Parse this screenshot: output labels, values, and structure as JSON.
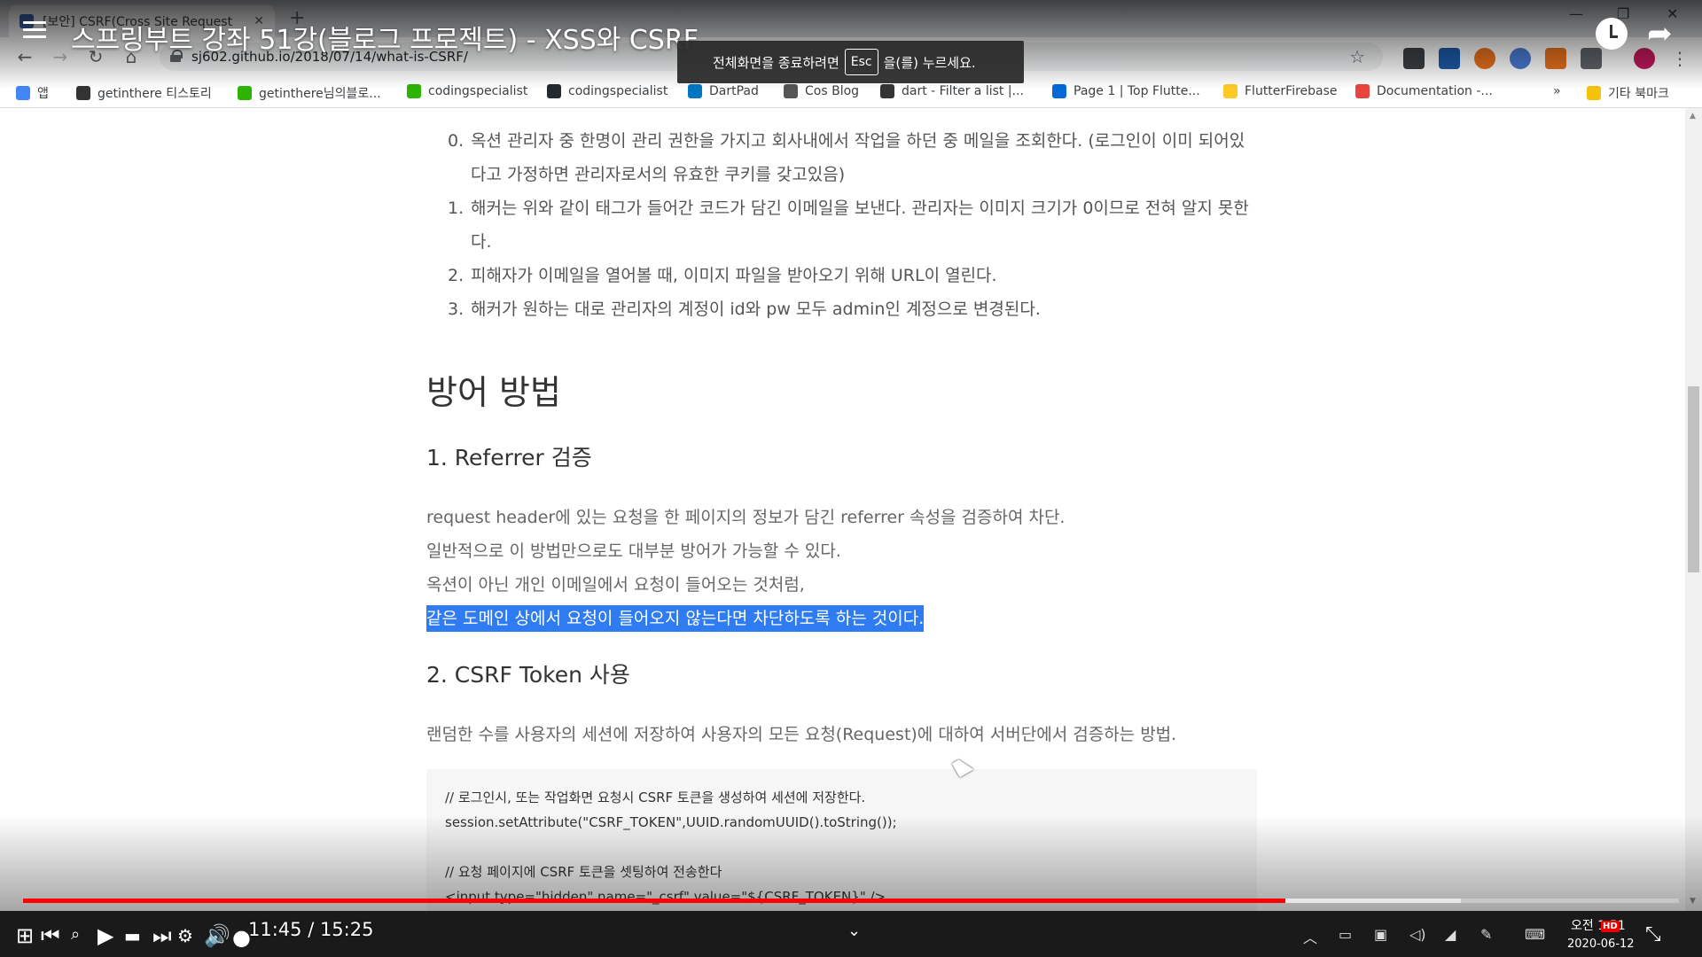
{
  "browser": {
    "tab_title": "[보안] CSRF(Cross Site Request",
    "tab_close": "✕",
    "new_tab": "+",
    "url": "sj602.github.io/2018/07/14/what-is-CSRF/",
    "bookmarks": [
      {
        "label": "앱",
        "color": "#4285f4"
      },
      {
        "label": "getinthere 티스토리",
        "color": "#333"
      },
      {
        "label": "getinthere님의블로...",
        "color": "#2db400"
      },
      {
        "label": "codingspecialist",
        "color": "#2db400"
      },
      {
        "label": "codingspecialist",
        "color": "#24292e"
      },
      {
        "label": "DartPad",
        "color": "#0175c2"
      },
      {
        "label": "Cos Blog",
        "color": "#555"
      },
      {
        "label": "dart - Filter a list |...",
        "color": "#333"
      },
      {
        "label": "Page 1 | Top Flutte...",
        "color": "#0468d7"
      },
      {
        "label": "FlutterFirebase",
        "color": "#ffca28"
      },
      {
        "label": "Documentation -...",
        "color": "#e8453c"
      }
    ],
    "bookmarks_more": "»",
    "other_bookmarks": "기타 북마크"
  },
  "youtube": {
    "title": "스프링부트 강좌 51강(블로그 프로젝트) - XSS와 CSRF",
    "esc_prefix": "전체화면을 종료하려면",
    "esc_key": "Esc",
    "esc_suffix": "을(를) 누르세요.",
    "time": "11:45 / 15:25",
    "progress_fraction": 0.7622,
    "buffer_fraction": 0.8683,
    "accent": "#ff0000"
  },
  "article": {
    "steps": [
      {
        "num": "0.",
        "text": "옥션 관리자 중 한명이 관리 권한을 가지고 회사내에서 작업을 하던 중 메일을 조회한다. (로그인이 이미 되어있다고 가정하면 관리자로서의 유효한 쿠키를 갖고있음)"
      },
      {
        "num": "1.",
        "text": "해커는 위와 같이 태그가 들어간 코드가 담긴 이메일을 보낸다. 관리자는 이미지 크기가 0이므로 전혀 알지 못한다."
      },
      {
        "num": "2.",
        "text": "피해자가 이메일을 열어볼 때, 이미지 파일을 받아오기 위해 URL이 열린다."
      },
      {
        "num": "3.",
        "text": "해커가 원하는 대로 관리자의 계정이 id와 pw 모두 admin인 계정으로 변경된다."
      }
    ],
    "section_title": "방어 방법",
    "sub1": "1. Referrer 검증",
    "sub1_lines": [
      "request header에 있는 요청을 한 페이지의 정보가 담긴 referrer 속성을 검증하여 차단.",
      "일반적으로 이 방법만으로도 대부분 방어가 가능할 수 있다.",
      "옥션이 아닌 개인 이메일에서 요청이 들어오는 것처럼,"
    ],
    "highlighted": "같은 도메인 상에서 요청이 들어오지 않는다면 차단하도록 하는 것이다.",
    "sub2": "2. CSRF Token 사용",
    "sub2_text": "랜덤한 수를 사용자의 세션에 저장하여 사용자의 모든 요청(Request)에 대하여 서버단에서 검증하는 방법.",
    "code": "// 로그인시, 또는 작업화면 요청시 CSRF 토큰을 생성하여 세션에 저장한다.\nsession.setAttribute(\"CSRF_TOKEN\",UUID.randomUUID().toString());\n\n// 요청 페이지에 CSRF 토큰을 셋팅하여 전송한다\n<input type=\"hidden\" name=\"_csrf\" value=\"${CSRF_TOKEN}\" />"
  },
  "taskbar": {
    "clock_time": "오전 1:51",
    "clock_date": "2020-06-12",
    "hd": "HD"
  }
}
